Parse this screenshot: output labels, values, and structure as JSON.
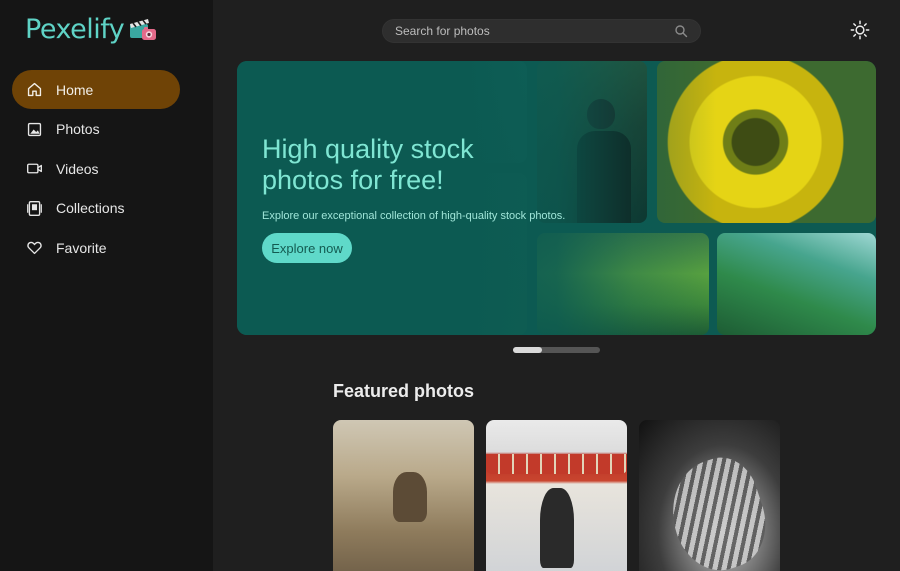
{
  "app": {
    "name": "Pexelify",
    "logo_icon": "clapperboard-camera-icon",
    "accent": "#5fd3c6"
  },
  "sidebar": {
    "items": [
      {
        "label": "Home",
        "icon": "home-icon",
        "active": true
      },
      {
        "label": "Photos",
        "icon": "image-icon",
        "active": false
      },
      {
        "label": "Videos",
        "icon": "video-icon",
        "active": false
      },
      {
        "label": "Collections",
        "icon": "collections-icon",
        "active": false
      },
      {
        "label": "Favorite",
        "icon": "heart-icon",
        "active": false
      }
    ],
    "active_color": "#6f4306"
  },
  "search": {
    "placeholder": "Search for photos",
    "value": ""
  },
  "theme_toggle": {
    "icon": "sun-icon"
  },
  "hero": {
    "title": "High quality stock photos for free!",
    "subtitle": "Explore our exceptional collection of high-quality stock photos.",
    "button_label": "Explore now",
    "carousel": {
      "slides": 3,
      "active": 1
    }
  },
  "featured": {
    "title": "Featured photos",
    "cards": [
      {
        "subject": "person-on-hay-field"
      },
      {
        "subject": "street-vendor-red-awning"
      },
      {
        "subject": "monstera-leaf-monochrome"
      }
    ]
  }
}
